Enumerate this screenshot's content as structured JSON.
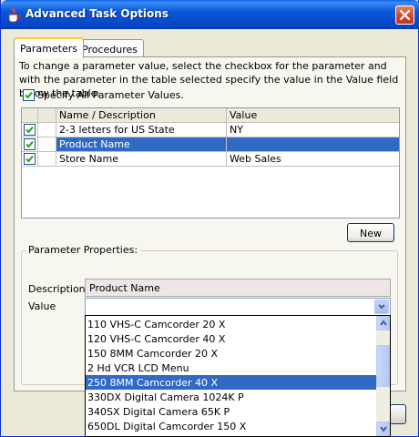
{
  "window": {
    "title": "Advanced Task Options"
  },
  "tabs": [
    {
      "label": "Parameters",
      "active": true
    },
    {
      "label": "Procedures",
      "active": false
    }
  ],
  "instructions": "To change a parameter value, select the checkbox for the parameter and with the parameter in the table selected specify the value in the Value field below the table.",
  "specify_all": {
    "label": "Specify All Parameter Values.",
    "checked": true
  },
  "table": {
    "columns": [
      "Name / Description",
      "Value"
    ],
    "rows": [
      {
        "checked": true,
        "name": "2-3 letters for US State",
        "value": "NY",
        "selected": false
      },
      {
        "checked": true,
        "name": "Product Name",
        "value": "",
        "selected": true
      },
      {
        "checked": true,
        "name": "Store Name",
        "value": "Web Sales",
        "selected": false
      }
    ]
  },
  "new_button": "New",
  "properties": {
    "title": "Parameter Properties:",
    "description_label": "Description",
    "description_value": "Product Name",
    "value_label": "Value",
    "value_current": ""
  },
  "dropdown": {
    "options": [
      "110 VHS-C Camcorder 20 X",
      "120 VHS-C Camcorder 40 X",
      "150 8MM Camcorder 20 X",
      "2 Hd VCR LCD Menu",
      "250 8MM Camcorder 40 X",
      "330DX Digital Camera 1024K P",
      "340SX Digital Camera 65K P",
      "650DL Digital Camcorder 150 X"
    ],
    "highlighted_index": 4
  },
  "colors": {
    "selection": "#316ac5",
    "title_bar": "#0a56d6",
    "face": "#ece9d8"
  },
  "icons": {
    "app": "java-cup-icon",
    "close": "close-icon",
    "check": "checkmark-icon",
    "dropdown": "chevron-down-icon",
    "scroll_up": "arrow-up-icon",
    "scroll_down": "arrow-down-icon"
  }
}
